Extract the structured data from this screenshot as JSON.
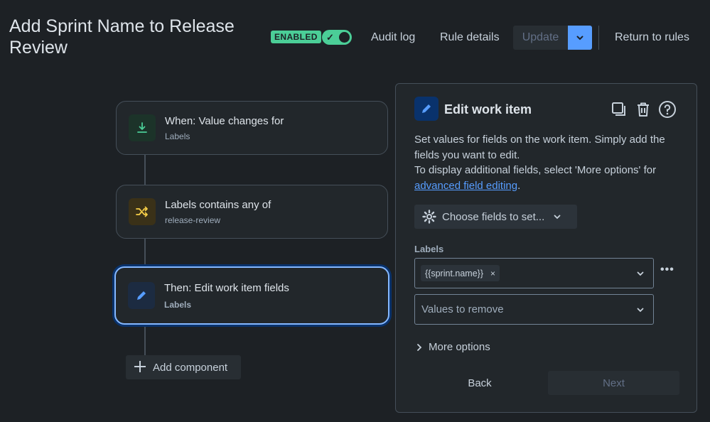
{
  "header": {
    "title": "Add Sprint Name to Release Review",
    "status_badge": "ENABLED",
    "toggle_check": "✓",
    "audit_log": "Audit log",
    "rule_details": "Rule details",
    "update": "Update",
    "return_to_rules": "Return to rules"
  },
  "flow": {
    "trigger": {
      "title": "When: Value changes for",
      "subtitle": "Labels",
      "icon": "download-icon",
      "color": "#4bce97"
    },
    "condition": {
      "title": "Labels contains any of",
      "subtitle": "release-review",
      "icon": "shuffle-icon",
      "color": "#f5cd47"
    },
    "action": {
      "title": "Then: Edit work item fields",
      "subtitle": "Labels",
      "icon": "pencil-icon",
      "color": "#579dff"
    },
    "add_component": "Add component"
  },
  "panel": {
    "title": "Edit work item",
    "desc_line1": "Set values for fields on the work item. Simply add the fields you want to edit.",
    "desc_line2": "To display additional fields, select 'More options' for",
    "desc_link": "advanced field editing",
    "desc_end": ".",
    "choose_fields": "Choose fields to set...",
    "labels_label": "Labels",
    "labels_tag": "{{sprint.name}}",
    "tag_remove": "×",
    "values_to_remove_placeholder": "Values to remove",
    "more_icon": "•••",
    "more_options": "More options",
    "back": "Back",
    "next": "Next"
  },
  "colors": {
    "accent": "#579dff",
    "success": "#4bce97",
    "background": "#1d2125"
  }
}
